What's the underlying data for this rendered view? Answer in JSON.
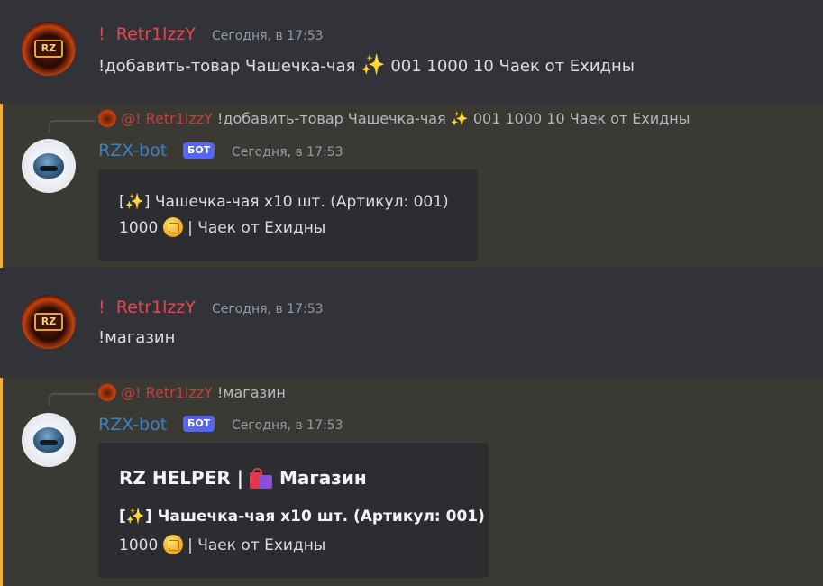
{
  "messages": [
    {
      "author": "Retr1lzzY",
      "prefix": "!",
      "time": "Сегодня, в 17:53",
      "text_a": "!добавить-товар Чашечка-чая",
      "text_b": "001 1000 10 Чаек от Ехидны"
    },
    {
      "author": "RZX-bot",
      "badge": "БОТ",
      "time": "Сегодня, в 17:53",
      "reply": {
        "mention": "@!",
        "author": "Retr1lzzY",
        "text_a": "!добавить-товар Чашечка-чая",
        "text_b": "001 1000 10 Чаек от Ехидны"
      },
      "embed": {
        "line1_open": "[",
        "line1_rest": "] Чашечка-чая x10 шт. (Артикул: 001)",
        "line2_price": "1000",
        "line2_rest": "| Чаек от Ехидны"
      }
    },
    {
      "author": "Retr1lzzY",
      "prefix": "!",
      "time": "Сегодня, в 17:53",
      "text": "!магазин"
    },
    {
      "author": "RZX-bot",
      "badge": "БОТ",
      "time": "Сегодня, в 17:53",
      "reply": {
        "mention": "@!",
        "author": "Retr1lzzY",
        "text": "!магазин"
      },
      "embed": {
        "title_a": "RZ HELPER |",
        "title_b": "Магазин",
        "line1_open": "[",
        "line1_rest": "] Чашечка-чая x10 шт. (Артикул: 001)",
        "line2_price": "1000",
        "line2_rest": "| Чаек от Ехидны"
      }
    }
  ],
  "icons": {
    "sparkle": "sparkles-icon",
    "coin": "coin-icon",
    "bags": "shopping-bags-icon"
  },
  "avatar_monogram": "RZ",
  "colors": {
    "user_name": "#e9474e",
    "bot_name": "#3b82c4",
    "badge": "#5865f2",
    "highlight_bar": "#f0b232"
  }
}
